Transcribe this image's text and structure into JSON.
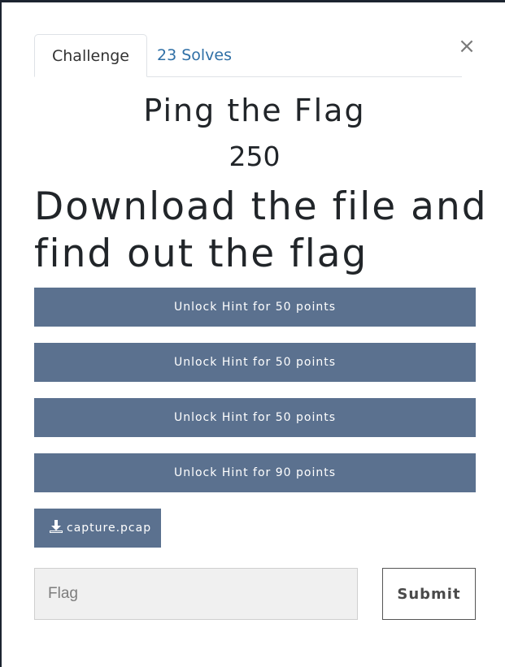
{
  "modal": {
    "close_label": "×",
    "tabs": [
      {
        "label": "Challenge"
      },
      {
        "label": "23 Solves"
      }
    ],
    "challenge": {
      "title": "Ping the Flag",
      "points": "250",
      "description": "Download the file and find out the flag"
    },
    "hints": [
      {
        "label": "Unlock Hint for 50 points"
      },
      {
        "label": "Unlock Hint for 50 points"
      },
      {
        "label": "Unlock Hint for 50 points"
      },
      {
        "label": "Unlock Hint for 90 points"
      }
    ],
    "file": {
      "name": "capture.pcap",
      "icon": "download-icon"
    },
    "flag_input": {
      "placeholder": "Flag",
      "value": ""
    },
    "submit_label": "Submit"
  },
  "colors": {
    "button_bg": "#5b718f",
    "tab_link": "#2f6fa6",
    "input_bg": "#f0f0f0"
  }
}
